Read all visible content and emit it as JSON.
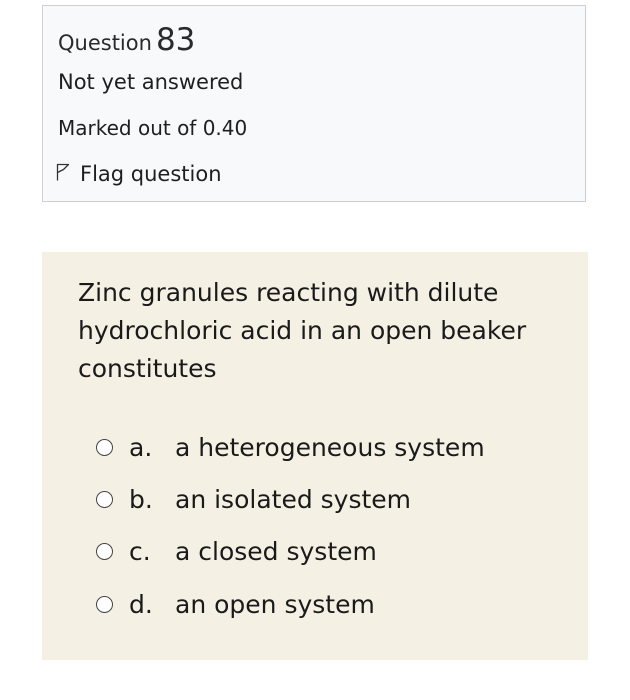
{
  "info": {
    "question_label": "Question",
    "question_number": "83",
    "state": "Not yet answered",
    "grade": "Marked out of 0.40",
    "flag_label": "Flag question"
  },
  "question": {
    "text": "Zinc granules reacting with dilute hydrochloric acid in an open beaker constitutes",
    "answers": [
      {
        "letter": "a.",
        "text": "a heterogeneous system"
      },
      {
        "letter": "b.",
        "text": "an isolated system"
      },
      {
        "letter": "c.",
        "text": "a closed system"
      },
      {
        "letter": "d.",
        "text": "an open system"
      }
    ]
  }
}
